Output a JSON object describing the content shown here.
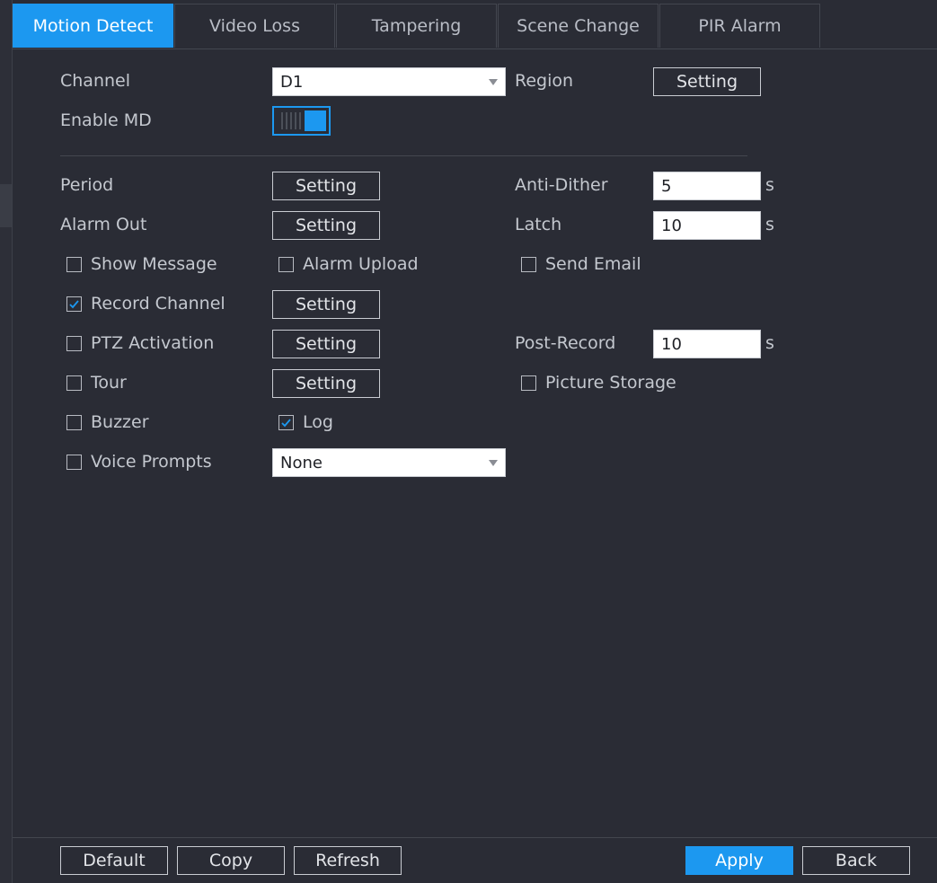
{
  "tabs": [
    "Motion Detect",
    "Video Loss",
    "Tampering",
    "Scene Change",
    "PIR Alarm"
  ],
  "active_tab": "Motion Detect",
  "form": {
    "channel_label": "Channel",
    "channel_value": "D1",
    "region_label": "Region",
    "region_button": "Setting",
    "enable_md_label": "Enable MD",
    "enable_md_on": true,
    "period_label": "Period",
    "period_button": "Setting",
    "anti_dither_label": "Anti-Dither",
    "anti_dither_value": "5",
    "anti_dither_unit": "s",
    "alarm_out_label": "Alarm Out",
    "alarm_out_button": "Setting",
    "latch_label": "Latch",
    "latch_value": "10",
    "latch_unit": "s",
    "show_message_label": "Show Message",
    "show_message_checked": false,
    "alarm_upload_label": "Alarm Upload",
    "alarm_upload_checked": false,
    "send_email_label": "Send Email",
    "send_email_checked": false,
    "record_channel_label": "Record Channel",
    "record_channel_checked": true,
    "record_channel_button": "Setting",
    "ptz_activation_label": "PTZ Activation",
    "ptz_activation_checked": false,
    "ptz_activation_button": "Setting",
    "post_record_label": "Post-Record",
    "post_record_value": "10",
    "post_record_unit": "s",
    "tour_label": "Tour",
    "tour_checked": false,
    "tour_button": "Setting",
    "picture_storage_label": "Picture Storage",
    "picture_storage_checked": false,
    "buzzer_label": "Buzzer",
    "buzzer_checked": false,
    "log_label": "Log",
    "log_checked": true,
    "voice_prompts_label": "Voice Prompts",
    "voice_prompts_checked": false,
    "voice_prompts_value": "None"
  },
  "footer": {
    "default": "Default",
    "copy": "Copy",
    "refresh": "Refresh",
    "apply": "Apply",
    "back": "Back"
  },
  "colors": {
    "accent": "#1c98f0",
    "background": "#2a2c35"
  }
}
